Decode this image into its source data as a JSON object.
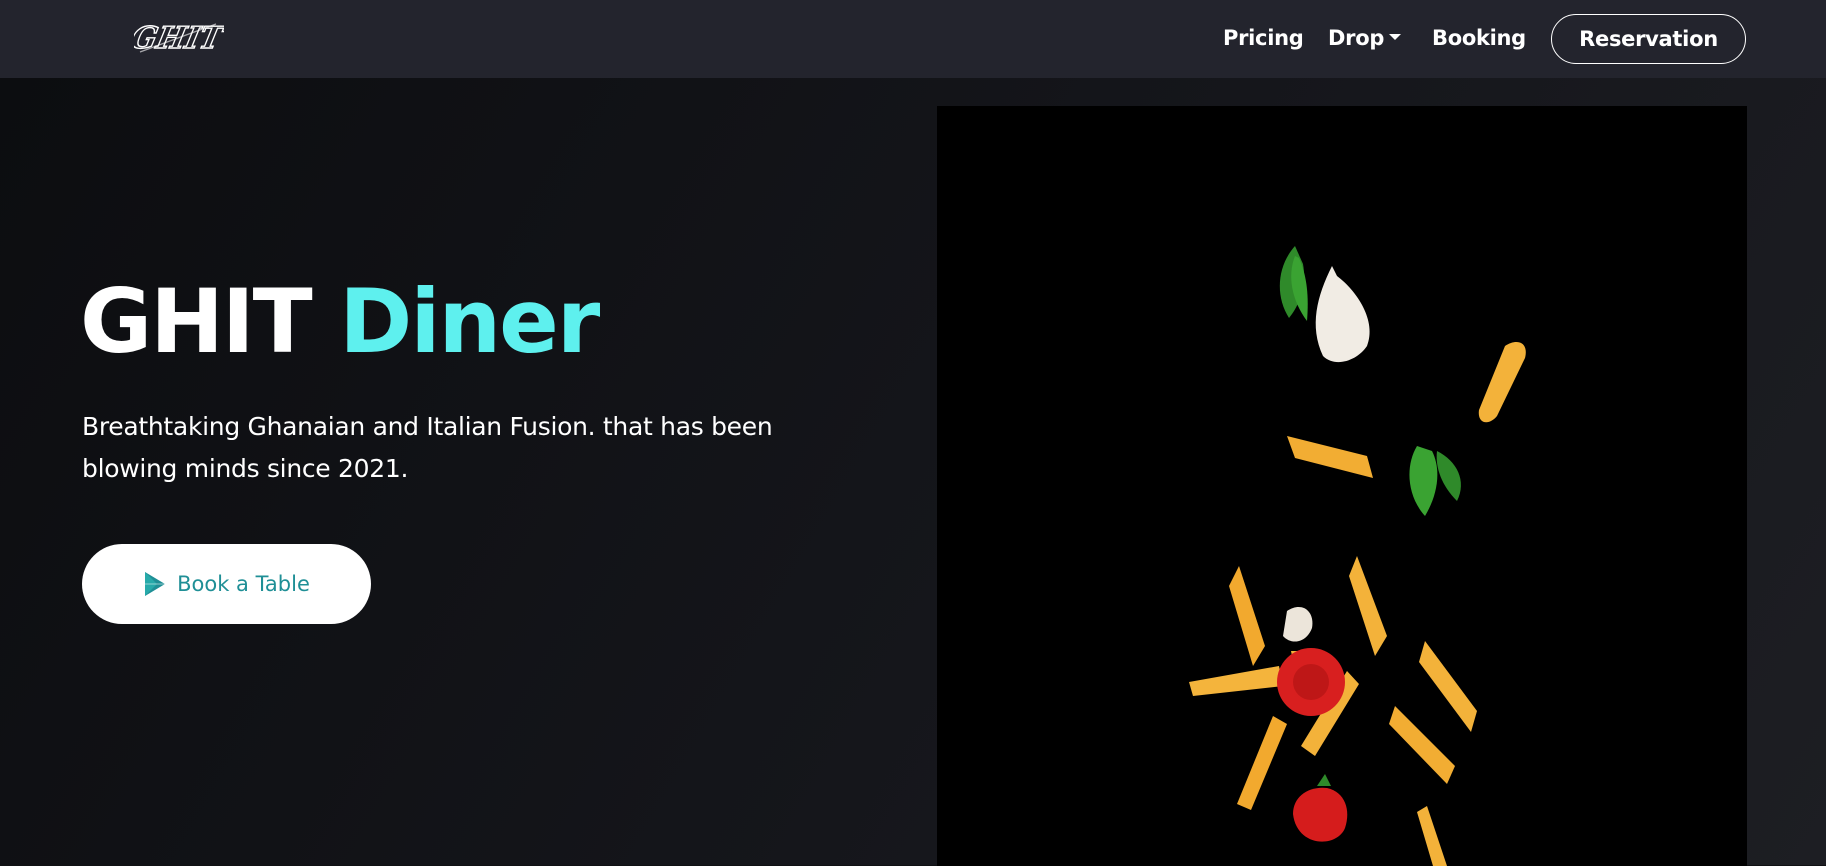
{
  "navbar": {
    "logo_text": "GHIT",
    "links": {
      "pricing": "Pricing",
      "drop": "Drop",
      "booking": "Booking"
    },
    "reservation_label": "Reservation"
  },
  "hero": {
    "title_main": "GHIT",
    "title_accent": "Diner",
    "subtitle": "Breathtaking Ghanaian and Italian Fusion. that has been blowing minds since 2021.",
    "book_button_label": "Book a Table",
    "book_button_icon": "play-icon"
  },
  "colors": {
    "navbar_bg": "#23242d",
    "page_bg": "#101114",
    "accent": "#5ef0ee",
    "button_text": "#1f8f96"
  }
}
